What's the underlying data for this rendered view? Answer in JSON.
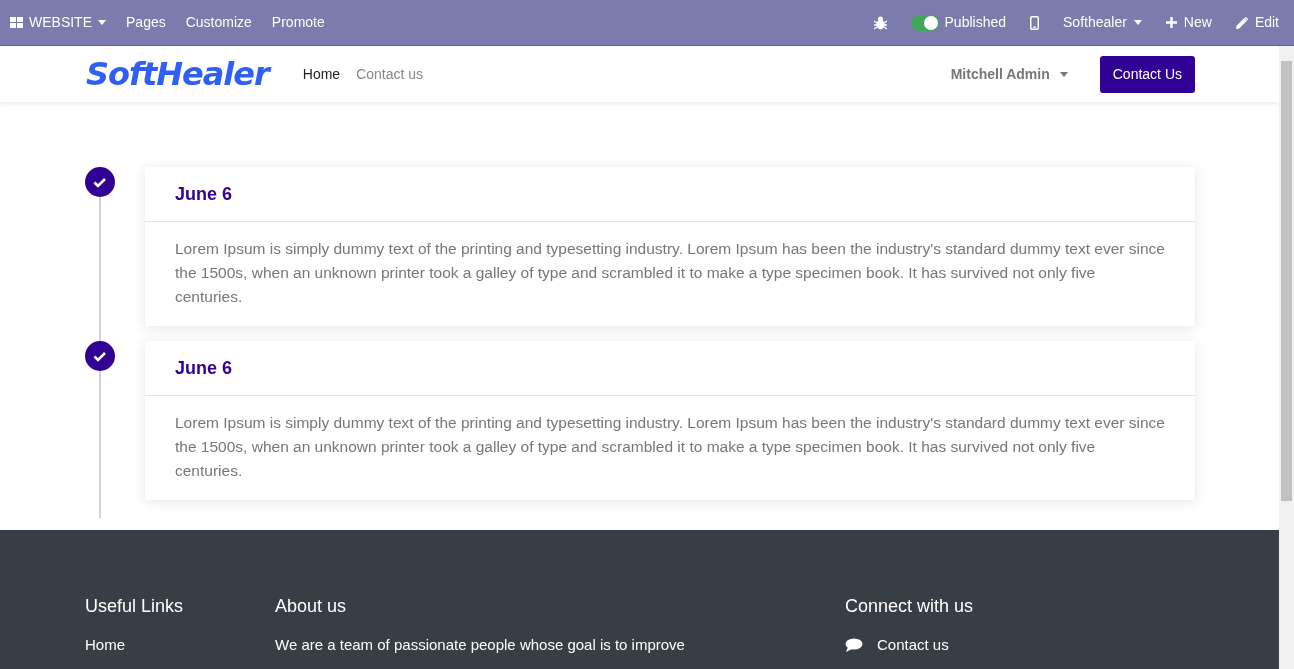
{
  "admin_bar": {
    "left": [
      {
        "kind": "apps",
        "label": "WEBSITE"
      },
      {
        "kind": "link",
        "label": "Pages"
      },
      {
        "kind": "link",
        "label": "Customize"
      },
      {
        "kind": "link",
        "label": "Promote"
      }
    ],
    "published": {
      "label": "Published",
      "on": true
    },
    "right": [
      {
        "kind": "dropdown",
        "label": "Softhealer"
      },
      {
        "kind": "new",
        "label": "New"
      },
      {
        "kind": "edit",
        "label": "Edit"
      }
    ]
  },
  "navbar": {
    "logo": "SoftHealer",
    "links": [
      {
        "label": "Home",
        "selected": true
      },
      {
        "label": "Contact us",
        "selected": false
      }
    ],
    "user": "Mitchell Admin",
    "cta": "Contact Us"
  },
  "timeline": [
    {
      "title": "June 6",
      "text": "Lorem Ipsum is simply dummy text of the printing and typesetting industry. Lorem Ipsum has been the industry's standard dummy text ever since the 1500s, when an unknown printer took a galley of type and scrambled it to make a type specimen book. It has survived not only five centuries."
    },
    {
      "title": "June 6",
      "text": "Lorem Ipsum is simply dummy text of the printing and typesetting industry. Lorem Ipsum has been the industry's standard dummy text ever since the 1500s, when an unknown printer took a galley of type and scrambled it to make a type specimen book. It has survived not only five centuries."
    }
  ],
  "footer": {
    "useful_links": {
      "title": "Useful Links",
      "items": [
        "Home"
      ]
    },
    "about": {
      "title": "About us",
      "text": "We are a team of passionate people whose goal is to improve"
    },
    "connect": {
      "title": "Connect with us",
      "items": [
        "Contact us"
      ]
    }
  }
}
